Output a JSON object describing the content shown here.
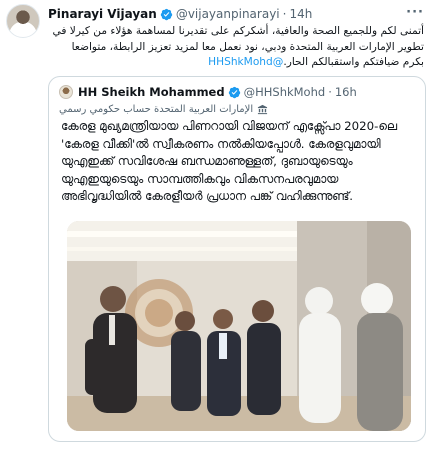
{
  "tweet": {
    "author_name": "Pinarayi Vijayan",
    "author_handle": "@vijayanpinarayi",
    "separator": "·",
    "time": "14h",
    "more_label": "···",
    "text": "أتمنى لكم وللجميع الصحة والعافية، أشكركم على تقديرنا لمساهمة هؤلاء من كيرلا في تطوير الإمارات العربية المتحدة ودبي، نود نعمل معا لمزيد تعزيز الرابطة، متواضعا بكرم ضيافتكم واستقبالكم الحار.",
    "mention": "@HHShkMohd"
  },
  "quote": {
    "author_name": "HH Sheikh Mohammed",
    "author_handle": "@HHShkMohd",
    "separator": "·",
    "time": "16h",
    "account_label": "الإمارات العربية المتحدة حساب حكومي رسمي",
    "text": "കേരള മുഖ്യമന്ത്രിയായ പിണറായി വിജയന് എക്സ്പോ 2020-ലെ 'കേരള വീക്കി'ൽ സ്വീകരണം നൽകിയപ്പോൾ. കേരളവുമായി യുഎഇക്ക് സവിശേഷ ബന്ധമാണുള്ളത്, ദുബായുടെയും യുഎഇയുടെയും സാമ്പത്തികവും വികസനപരവുമായ അഭിവൃദ്ധിയിൽ കേരളീയർ പ്രധാന പങ്ക് വഹിക്കുന്നുണ്ട്."
  },
  "colors": {
    "verified": "#1d9bf0",
    "link": "#1d9bf0",
    "muted": "#536471",
    "border": "#cfd9de"
  },
  "icons": {
    "verified": "verified-badge-icon",
    "more": "more-options-icon",
    "account_label": "government-account-icon"
  }
}
